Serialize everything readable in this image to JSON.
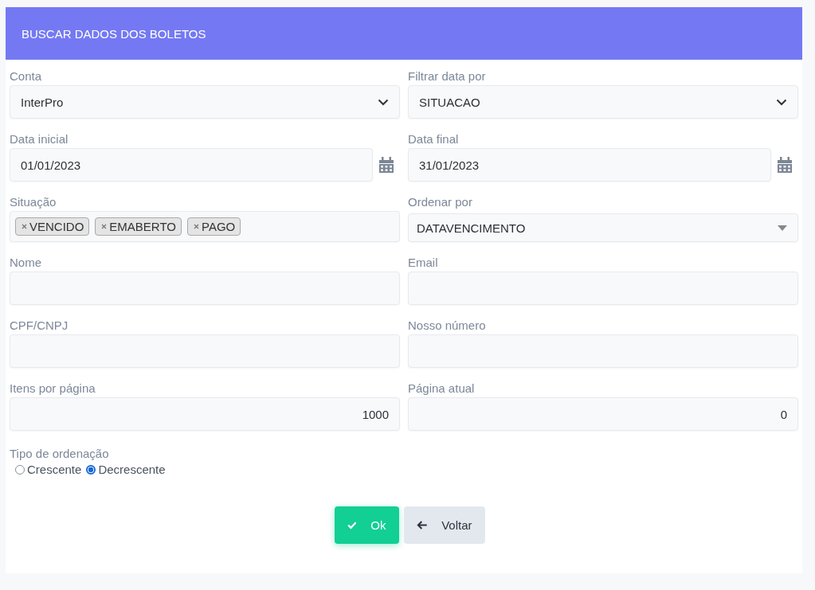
{
  "header": {
    "title": "BUSCAR DADOS DOS BOLETOS"
  },
  "fields": [
    {
      "kind": "select",
      "label": "Conta",
      "value": "InterPro"
    },
    {
      "kind": "select",
      "label": "Filtrar data por",
      "value": "SITUACAO"
    },
    {
      "kind": "date",
      "label": "Data inicial",
      "value": "01/01/2023"
    },
    {
      "kind": "date",
      "label": "Data final",
      "value": "31/01/2023"
    },
    {
      "kind": "tags",
      "label": "Situação",
      "tags": [
        "VENCIDO",
        "EMABERTO",
        "PAGO"
      ]
    },
    {
      "kind": "dropdown",
      "label": "Ordenar por",
      "value": "DATAVENCIMENTO"
    },
    {
      "kind": "text",
      "label": "Nome"
    },
    {
      "kind": "text",
      "label": "Email"
    },
    {
      "kind": "text",
      "label": "CPF/CNPJ"
    },
    {
      "kind": "text",
      "label": "Nosso número"
    },
    {
      "kind": "number",
      "label": "Itens por página",
      "value": "1000"
    },
    {
      "kind": "number",
      "label": "Página atual",
      "value": "0"
    }
  ],
  "sort_order": {
    "label": "Tipo de ordenação",
    "options": [
      {
        "label": "Crescente",
        "selected": false
      },
      {
        "label": "Decrescente",
        "selected": true
      }
    ]
  },
  "buttons": [
    {
      "kind": "ok",
      "label": "Ok"
    },
    {
      "kind": "back",
      "label": "Voltar"
    }
  ]
}
